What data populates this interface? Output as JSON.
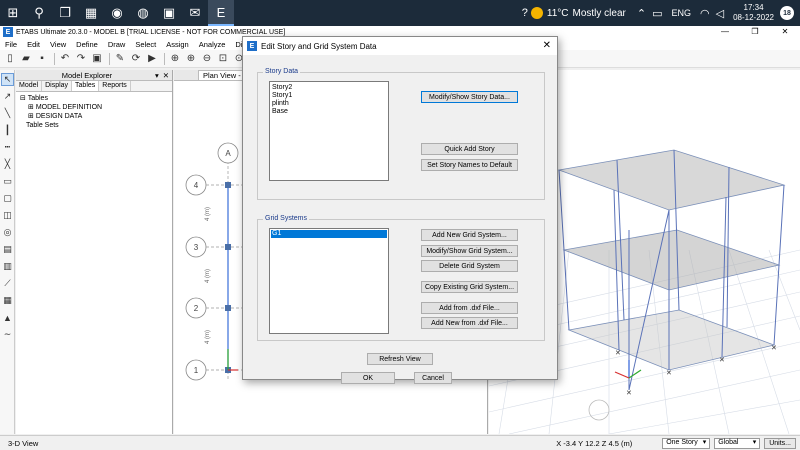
{
  "taskbar": {
    "weather_temp": "11°C",
    "weather_text": "Mostly clear",
    "language": "ENG",
    "time": "17:34",
    "date": "08-12-2022",
    "notifications": "18"
  },
  "app": {
    "title": "ETABS Ultimate 20.3.0 - MODEL B  [TRIAL LICENSE - NOT FOR COMMERCIAL USE]"
  },
  "menu": [
    "File",
    "Edit",
    "View",
    "Define",
    "Draw",
    "Select",
    "Assign",
    "Analyze",
    "Dis"
  ],
  "explorer": {
    "title": "Model Explorer",
    "tabs": [
      "Model",
      "Display",
      "Tables",
      "Reports"
    ],
    "tree": {
      "root": "Tables",
      "items": [
        "MODEL DEFINITION",
        "DESIGN DATA"
      ],
      "extra": "Table Sets"
    }
  },
  "planview": {
    "tab_label": "Plan View - St",
    "grid_letter": "A",
    "grid_numbers": [
      "4",
      "3",
      "2",
      "1"
    ],
    "dimension_label": "4 (m)"
  },
  "dialog": {
    "title": "Edit Story and Grid System Data",
    "story_group": "Story Data",
    "stories": [
      "Story2",
      "Story1",
      "plinth",
      "Base"
    ],
    "modify_story_btn": "Modify/Show Story Data...",
    "quick_add_btn": "Quick Add Story",
    "default_names_btn": "Set Story Names to Default",
    "grid_group": "Grid Systems",
    "grids": [
      "G1"
    ],
    "add_grid_btn": "Add New Grid System...",
    "modify_grid_btn": "Modify/Show Grid System...",
    "delete_grid_btn": "Delete Grid System",
    "copy_grid_btn": "Copy Existing Grid System...",
    "add_dxf_btn": "Add from .dxf File...",
    "add_new_dxf_btn": "Add New from .dxf File...",
    "refresh_btn": "Refresh View",
    "ok_btn": "OK",
    "cancel_btn": "Cancel"
  },
  "status": {
    "view": "3-D View",
    "coords": "X -3.4  Y 12.2  Z 4.5 (m)",
    "story_select": "One Story",
    "coord_select": "Global",
    "units_btn": "Units..."
  },
  "colors": {
    "accent": "#0078d7",
    "etabs_blue": "#1e6ec8",
    "taskbar": "#1c2b3a"
  }
}
